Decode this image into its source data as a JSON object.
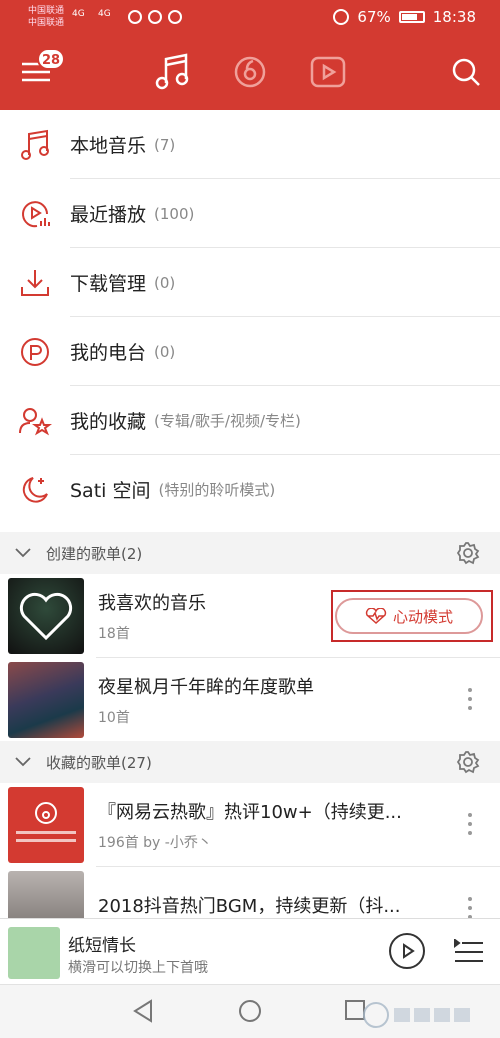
{
  "status": {
    "carrier1": "中国联通",
    "carrier2": "中国联通",
    "net1": "4G",
    "net2": "4G",
    "battery": "67%",
    "time": "18:38"
  },
  "header": {
    "badge": "28",
    "icons": [
      "menu-icon",
      "music-note-icon",
      "netease-icon",
      "video-icon",
      "search-icon"
    ]
  },
  "menu": [
    {
      "label": "本地音乐",
      "count": "(7)",
      "icon": "music-note-icon"
    },
    {
      "label": "最近播放",
      "count": "(100)",
      "icon": "recent-play-icon"
    },
    {
      "label": "下载管理",
      "count": "(0)",
      "icon": "download-icon"
    },
    {
      "label": "我的电台",
      "count": "(0)",
      "icon": "radio-icon"
    },
    {
      "label": "我的收藏",
      "count": "(专辑/歌手/视频/专栏)",
      "icon": "favorite-icon"
    },
    {
      "label": "Sati 空间",
      "count": "(特别的聆听模式)",
      "icon": "moon-icon"
    }
  ],
  "created": {
    "title": "创建的歌单(2)",
    "items": [
      {
        "name": "我喜欢的音乐",
        "sub": "18首"
      },
      {
        "name": "夜星枫月千年眸的年度歌单",
        "sub": "10首"
      }
    ],
    "heart_mode": "心动模式"
  },
  "collected": {
    "title": "收藏的歌单(27)",
    "items": [
      {
        "name": "『网易云热歌』热评10w+（持续更...",
        "sub": "196首 by -小乔丶"
      },
      {
        "name": "2018抖音热门BGM，持续更新（抖...",
        "sub": ""
      }
    ]
  },
  "player": {
    "title": "纸短情长",
    "sub": "横滑可以切换上下首哦"
  },
  "colors": {
    "brand": "#d33a31",
    "accent_box": "#c72a2a"
  }
}
